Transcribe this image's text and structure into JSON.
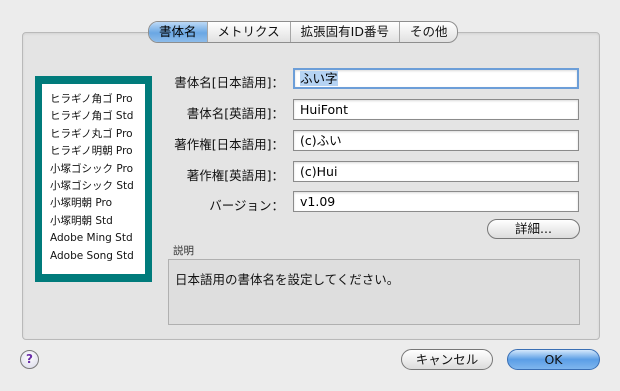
{
  "tabs": [
    {
      "label": "書体名",
      "active": true
    },
    {
      "label": "メトリクス",
      "active": false
    },
    {
      "label": "拡張固有ID番号",
      "active": false
    },
    {
      "label": "その他",
      "active": false
    }
  ],
  "preview": {
    "fonts": [
      "ヒラギノ角ゴ Pro",
      "ヒラギノ角ゴ Std",
      "ヒラギノ丸ゴ Pro",
      "ヒラギノ明朝 Pro",
      "小塚ゴシック Pro",
      "小塚ゴシック Std",
      "小塚明朝 Pro",
      "小塚明朝 Std",
      "Adobe Ming Std",
      "Adobe Song Std"
    ]
  },
  "form": {
    "name_ja_label": "書体名[日本語用]：",
    "name_ja_value": "ふい字",
    "name_en_label": "書体名[英語用]：",
    "name_en_value": "HuiFont",
    "copyright_ja_label": "著作権[日本語用]：",
    "copyright_ja_value": "(c)ふい",
    "copyright_en_label": "著作権[英語用]：",
    "copyright_en_value": "(c)Hui",
    "version_label": "バージョン：",
    "version_value": "v1.09",
    "details_button": "詳細..."
  },
  "description": {
    "title": "説明",
    "text": "日本語用の書体名を設定してください。"
  },
  "footer": {
    "help": "?",
    "cancel": "キャンセル",
    "ok": "OK"
  }
}
